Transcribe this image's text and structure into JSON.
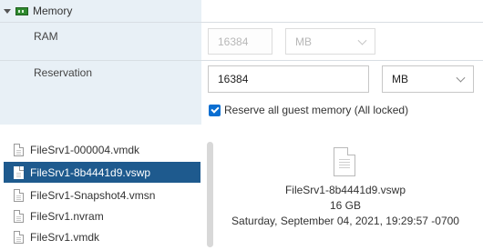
{
  "memory": {
    "section_title": "Memory",
    "ram": {
      "label": "RAM",
      "value": "16384",
      "unit": "MB"
    },
    "reservation": {
      "label": "Reservation",
      "value": "16384",
      "unit": "MB"
    },
    "reserve_all": {
      "checked": true,
      "label": "Reserve all guest memory (All locked)"
    }
  },
  "files": [
    {
      "name": "FileSrv1-000004.vmdk",
      "selected": false
    },
    {
      "name": "FileSrv1-8b4441d9.vswp",
      "selected": true
    },
    {
      "name": "FileSrv1-Snapshot4.vmsn",
      "selected": false
    },
    {
      "name": "FileSrv1.nvram",
      "selected": false
    },
    {
      "name": "FileSrv1.vmdk",
      "selected": false
    }
  ],
  "preview": {
    "file_name": "FileSrv1-8b4441d9.vswp",
    "size": "16 GB",
    "modified": "Saturday, September 04, 2021, 19:29:57 -0700"
  },
  "colors": {
    "selected_row": "#1e5a8e",
    "label_column": "#e8f0f6",
    "checkbox": "#0a6ed1"
  }
}
